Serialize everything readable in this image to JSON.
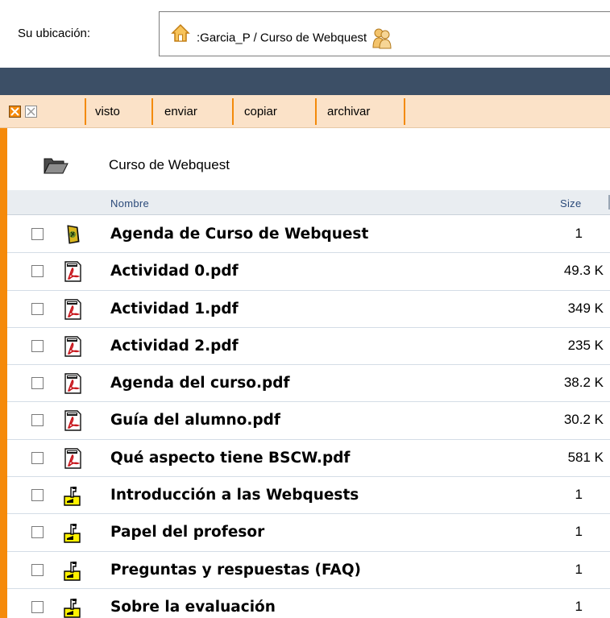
{
  "location": {
    "label": "Su ubicación:",
    "path": ":Garcia_P / Curso de Webquest"
  },
  "toolbar": {
    "buttons": [
      "visto",
      "enviar",
      "copiar",
      "archivar"
    ]
  },
  "folder": {
    "name": "Curso de Webquest"
  },
  "columns": {
    "name": "Nombre",
    "size": "Size"
  },
  "items": [
    {
      "name": "Agenda de Curso de Webquest",
      "size": "1",
      "icon": "agenda-icon"
    },
    {
      "name": "Actividad 0.pdf",
      "size": "49.3 K",
      "icon": "pdf-icon"
    },
    {
      "name": "Actividad 1.pdf",
      "size": "349 K",
      "icon": "pdf-icon"
    },
    {
      "name": "Actividad 2.pdf",
      "size": "235 K",
      "icon": "pdf-icon"
    },
    {
      "name": "Agenda del curso.pdf",
      "size": "38.2 K",
      "icon": "pdf-icon"
    },
    {
      "name": "Guía del alumno.pdf",
      "size": "30.2 K",
      "icon": "pdf-icon"
    },
    {
      "name": "Qué aspecto tiene BSCW.pdf",
      "size": "581 K",
      "icon": "pdf-icon"
    },
    {
      "name": "Introducción a las Webquests",
      "size": "1",
      "icon": "discussion-icon"
    },
    {
      "name": "Papel del profesor",
      "size": "1",
      "icon": "discussion-icon"
    },
    {
      "name": "Preguntas y respuestas (FAQ)",
      "size": "1",
      "icon": "discussion-icon"
    },
    {
      "name": "Sobre la evaluación",
      "size": "1",
      "icon": "discussion-icon"
    }
  ],
  "colors": {
    "accent_orange": "#f58a0b",
    "dark_bar": "#3c4f66",
    "toolbar_bg": "#fbe2c8"
  }
}
